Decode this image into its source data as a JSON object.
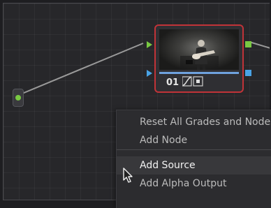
{
  "node_editor": {
    "node": {
      "number": "01",
      "border_color": "#c13338",
      "icons": [
        "curve-icon",
        "lut-icon"
      ]
    },
    "ports": {
      "rgb_color": "#79c942",
      "alpha_color": "#49a3e6"
    }
  },
  "context_menu": {
    "items": [
      {
        "label": "Reset All Grades and Nodes"
      },
      {
        "label": "Add Node"
      },
      {
        "label": "Add Source"
      },
      {
        "label": "Add Alpha Output"
      }
    ],
    "hovered": "Add Source"
  }
}
